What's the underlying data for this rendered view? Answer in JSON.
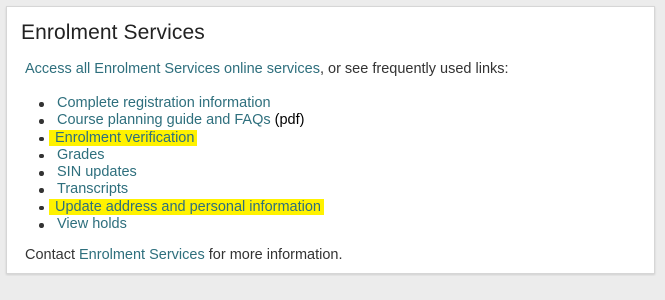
{
  "title": "Enrolment Services",
  "intro": {
    "link_text": "Access all Enrolment Services online services",
    "rest_text": ", or see frequently used links:"
  },
  "links": [
    {
      "label": "Complete registration information",
      "highlighted": false
    },
    {
      "label": "Course planning guide and FAQs",
      "suffix": " (pdf)",
      "highlighted": false
    },
    {
      "label": "Enrolment verification",
      "highlighted": true
    },
    {
      "label": "Grades",
      "highlighted": false
    },
    {
      "label": "SIN updates",
      "highlighted": false
    },
    {
      "label": "Transcripts",
      "highlighted": false
    },
    {
      "label": "Update address and personal information",
      "highlighted": true
    },
    {
      "label": "View holds",
      "highlighted": false
    }
  ],
  "contact": {
    "prefix": "Contact ",
    "link_text": "Enrolment Services",
    "suffix": " for more information."
  },
  "colors": {
    "link": "#2e6f7d",
    "highlight": "#fff200",
    "text": "#333333"
  }
}
